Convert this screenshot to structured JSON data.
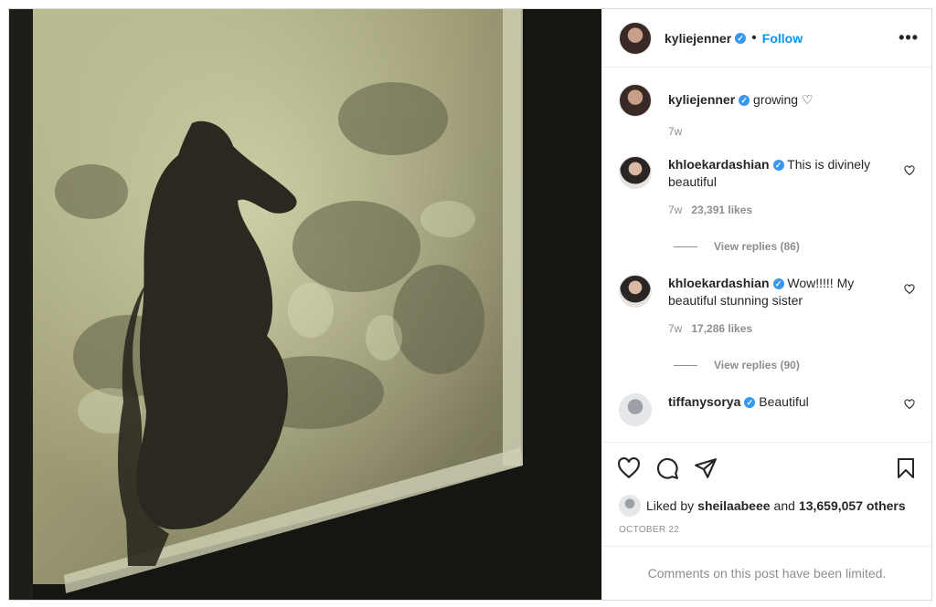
{
  "header": {
    "username": "kyliejenner",
    "separator": "•",
    "follow_label": "Follow",
    "more_icon": "•••"
  },
  "caption": {
    "username": "kyliejenner",
    "text": "growing ♡",
    "time": "7w"
  },
  "comments": [
    {
      "username": "khloekardashian",
      "text": "This is divinely beautiful",
      "time": "7w",
      "likes": "23,391 likes",
      "replies": "View replies (86)"
    },
    {
      "username": "khloekardashian",
      "text": "Wow!!!!! My beautiful stunning sister",
      "time": "7w",
      "likes": "17,286 likes",
      "replies": "View replies (90)"
    },
    {
      "username": "tiffanysorya",
      "text": "Beautiful"
    }
  ],
  "likes": {
    "prefix": "Liked by",
    "user": "sheilaabeee",
    "and": "and",
    "count": "13,659,057 others"
  },
  "date": "OCTOBER 22",
  "limited_text": "Comments on this post have been limited.",
  "icons": [
    "heart-icon",
    "comment-icon",
    "share-icon",
    "bookmark-icon",
    "more-icon",
    "verified-icon"
  ],
  "colors": {
    "accent": "#0095f6",
    "verified": "#3897f0",
    "muted": "#8e8e8e"
  }
}
